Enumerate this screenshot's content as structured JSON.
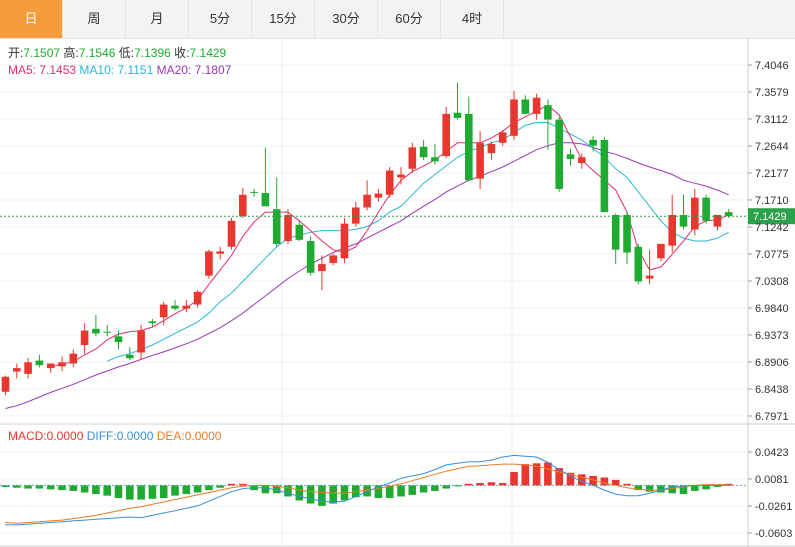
{
  "tabs": [
    {
      "label": "日",
      "active": true
    },
    {
      "label": "周",
      "active": false
    },
    {
      "label": "月",
      "active": false
    },
    {
      "label": "5分",
      "active": false
    },
    {
      "label": "15分",
      "active": false
    },
    {
      "label": "30分",
      "active": false
    },
    {
      "label": "60分",
      "active": false
    },
    {
      "label": "4时",
      "active": false
    }
  ],
  "ohlc_legend": {
    "open_label": "开:",
    "open_value": "7.1507",
    "high_label": "高:",
    "high_value": "7.1546",
    "low_label": "低:",
    "low_value": "7.1396",
    "close_label": "收:",
    "close_value": "7.1429"
  },
  "ma_legend": {
    "ma5_label": "MA5:",
    "ma5_value": "7.1453",
    "ma10_label": "MA10:",
    "ma10_value": "7.1151",
    "ma20_label": "MA20:",
    "ma20_value": "7.1807"
  },
  "macd_legend": {
    "macd_label": "MACD:",
    "macd_value": "0.0000",
    "diff_label": "DIFF:",
    "diff_value": "0.0000",
    "dea_label": "DEA:",
    "dea_value": "0.0000"
  },
  "colors": {
    "up": "#e8372e",
    "down": "#1fab32",
    "ma5": "#e0306a",
    "ma10": "#2bb6d8",
    "ma20": "#9a3ab8",
    "diff": "#3a8edb",
    "dea": "#ef7b20",
    "last_price_line": "#2aa14b"
  },
  "chart_data": {
    "type": "candlestick",
    "last_price": 7.1429,
    "last_price_label": "7.1429",
    "price_axis": {
      "min": 6.7971,
      "max": 7.4046,
      "ticks": [
        "7.4046",
        "7.3579",
        "7.3112",
        "7.2644",
        "7.2177",
        "7.1710",
        "7.1242",
        "7.0775",
        "7.0308",
        "6.9840",
        "6.9373",
        "6.8906",
        "6.8438",
        "6.7971"
      ]
    },
    "candles": [
      [
        6.839,
        6.867,
        6.833,
        6.865
      ],
      [
        6.874,
        6.888,
        6.862,
        6.88
      ],
      [
        6.87,
        6.898,
        6.862,
        6.89
      ],
      [
        6.893,
        6.903,
        6.881,
        6.885
      ],
      [
        6.88,
        6.888,
        6.872,
        6.888
      ],
      [
        6.883,
        6.9,
        6.875,
        6.89
      ],
      [
        6.888,
        6.912,
        6.882,
        6.905
      ],
      [
        6.92,
        6.958,
        6.905,
        6.945
      ],
      [
        6.948,
        6.972,
        6.935,
        6.94
      ],
      [
        6.943,
        6.955,
        6.935,
        6.942
      ],
      [
        6.935,
        6.945,
        6.912,
        6.925
      ],
      [
        6.903,
        6.916,
        6.894,
        6.897
      ],
      [
        6.907,
        6.955,
        6.895,
        6.945
      ],
      [
        6.961,
        6.965,
        6.952,
        6.958
      ],
      [
        6.968,
        6.995,
        6.955,
        6.99
      ],
      [
        6.988,
        6.998,
        6.98,
        6.983
      ],
      [
        6.983,
        6.998,
        6.977,
        6.988
      ],
      [
        6.99,
        7.015,
        6.985,
        7.012
      ],
      [
        7.04,
        7.085,
        7.035,
        7.082
      ],
      [
        7.078,
        7.09,
        7.068,
        7.082
      ],
      [
        7.09,
        7.14,
        7.085,
        7.135
      ],
      [
        7.143,
        7.192,
        7.14,
        7.18
      ],
      [
        7.185,
        7.19,
        7.176,
        7.184
      ],
      [
        7.183,
        7.262,
        7.17,
        7.16
      ],
      [
        7.155,
        7.21,
        7.09,
        7.095
      ],
      [
        7.1,
        7.155,
        7.095,
        7.145
      ],
      [
        7.128,
        7.135,
        7.1,
        7.102
      ],
      [
        7.1,
        7.108,
        7.04,
        7.045
      ],
      [
        7.048,
        7.075,
        7.015,
        7.06
      ],
      [
        7.062,
        7.078,
        7.058,
        7.075
      ],
      [
        7.07,
        7.14,
        7.062,
        7.13
      ],
      [
        7.13,
        7.168,
        7.125,
        7.158
      ],
      [
        7.158,
        7.205,
        7.153,
        7.18
      ],
      [
        7.175,
        7.19,
        7.168,
        7.182
      ],
      [
        7.18,
        7.228,
        7.175,
        7.222
      ],
      [
        7.21,
        7.228,
        7.198,
        7.215
      ],
      [
        7.225,
        7.27,
        7.218,
        7.262
      ],
      [
        7.263,
        7.275,
        7.24,
        7.245
      ],
      [
        7.245,
        7.268,
        7.232,
        7.238
      ],
      [
        7.247,
        7.332,
        7.243,
        7.32
      ],
      [
        7.322,
        7.374,
        7.31,
        7.313
      ],
      [
        7.32,
        7.35,
        7.205,
        7.205
      ],
      [
        7.208,
        7.29,
        7.19,
        7.27
      ],
      [
        7.252,
        7.272,
        7.24,
        7.268
      ],
      [
        7.27,
        7.292,
        7.265,
        7.288
      ],
      [
        7.282,
        7.36,
        7.275,
        7.345
      ],
      [
        7.345,
        7.352,
        7.32,
        7.32
      ],
      [
        7.32,
        7.355,
        7.31,
        7.348
      ],
      [
        7.335,
        7.345,
        7.258,
        7.31
      ],
      [
        7.31,
        7.315,
        7.185,
        7.19
      ],
      [
        7.25,
        7.26,
        7.23,
        7.242
      ],
      [
        7.235,
        7.252,
        7.225,
        7.245
      ],
      [
        7.275,
        7.282,
        7.255,
        7.265
      ],
      [
        7.275,
        7.28,
        7.15,
        7.15
      ],
      [
        7.145,
        7.148,
        7.06,
        7.085
      ],
      [
        7.145,
        7.15,
        7.06,
        7.08
      ],
      [
        7.09,
        7.095,
        7.025,
        7.03
      ],
      [
        7.035,
        7.085,
        7.025,
        7.04
      ],
      [
        7.07,
        7.095,
        7.065,
        7.095
      ],
      [
        7.092,
        7.18,
        7.08,
        7.145
      ],
      [
        7.145,
        7.18,
        7.12,
        7.125
      ],
      [
        7.12,
        7.19,
        7.11,
        7.175
      ],
      [
        7.175,
        7.18,
        7.13,
        7.135
      ],
      [
        7.125,
        7.145,
        7.118,
        7.145
      ],
      [
        7.15,
        7.155,
        7.14,
        7.143
      ]
    ],
    "ma5": [
      null,
      null,
      null,
      null,
      6.882,
      6.887,
      6.891,
      6.903,
      6.913,
      6.929,
      6.939,
      6.943,
      6.945,
      6.951,
      6.962,
      6.974,
      6.984,
      6.998,
      7.025,
      7.05,
      7.075,
      7.108,
      7.133,
      7.15,
      7.15,
      7.15,
      7.135,
      7.118,
      7.1,
      7.085,
      7.08,
      7.09,
      7.118,
      7.15,
      7.18,
      7.205,
      7.22,
      7.23,
      7.24,
      7.255,
      7.27,
      7.27,
      7.27,
      7.278,
      7.29,
      7.305,
      7.315,
      7.325,
      7.335,
      7.318,
      7.28,
      7.24,
      7.222,
      7.205,
      7.188,
      7.15,
      7.085,
      7.05,
      7.055,
      7.077,
      7.1,
      7.125,
      7.135,
      7.137,
      7.145
    ],
    "ma10": [
      null,
      null,
      null,
      null,
      null,
      null,
      null,
      null,
      null,
      6.892,
      6.9,
      6.905,
      6.912,
      6.92,
      6.93,
      6.94,
      6.95,
      6.96,
      6.975,
      6.995,
      7.01,
      7.03,
      7.05,
      7.07,
      7.09,
      7.105,
      7.11,
      7.115,
      7.118,
      7.118,
      7.118,
      7.12,
      7.125,
      7.135,
      7.15,
      7.16,
      7.18,
      7.2,
      7.215,
      7.23,
      7.245,
      7.255,
      7.262,
      7.27,
      7.275,
      7.288,
      7.3,
      7.305,
      7.305,
      7.295,
      7.285,
      7.275,
      7.26,
      7.245,
      7.225,
      7.21,
      7.185,
      7.16,
      7.135,
      7.115,
      7.105,
      7.1,
      7.1,
      7.105,
      7.115
    ],
    "ma20": [
      6.81,
      6.815,
      6.822,
      6.83,
      6.838,
      6.845,
      6.852,
      6.86,
      6.868,
      6.875,
      6.882,
      6.888,
      6.895,
      6.902,
      6.908,
      6.915,
      6.922,
      6.93,
      6.94,
      6.95,
      6.962,
      6.975,
      6.99,
      7.005,
      7.02,
      7.035,
      7.048,
      7.06,
      7.07,
      7.08,
      7.088,
      7.095,
      7.105,
      7.115,
      7.125,
      7.135,
      7.148,
      7.16,
      7.172,
      7.185,
      7.195,
      7.205,
      7.212,
      7.22,
      7.228,
      7.238,
      7.248,
      7.258,
      7.265,
      7.27,
      7.27,
      7.268,
      7.262,
      7.255,
      7.25,
      7.243,
      7.235,
      7.228,
      7.222,
      7.215,
      7.205,
      7.2,
      7.195,
      7.188,
      7.18
    ],
    "macd_axis": {
      "min": -0.0603,
      "max": 0.0423,
      "ticks": [
        "0.0423",
        "0.0081",
        "-0.0261",
        "-0.0603"
      ]
    },
    "macd_hist": [
      -0.002,
      -0.003,
      -0.004,
      -0.004,
      -0.005,
      -0.006,
      -0.007,
      -0.009,
      -0.011,
      -0.013,
      -0.016,
      -0.018,
      -0.018,
      -0.017,
      -0.016,
      -0.013,
      -0.011,
      -0.009,
      -0.006,
      -0.003,
      0.002,
      0.002,
      -0.006,
      -0.01,
      -0.01,
      -0.014,
      -0.019,
      -0.023,
      -0.026,
      -0.023,
      -0.019,
      -0.015,
      -0.014,
      -0.016,
      -0.016,
      -0.014,
      -0.012,
      -0.009,
      -0.007,
      -0.004,
      -0.001,
      0.002,
      0.003,
      0.004,
      0.003,
      0.017,
      0.027,
      0.028,
      0.029,
      0.022,
      0.016,
      0.014,
      0.012,
      0.01,
      0.007,
      0.002,
      -0.006,
      -0.008,
      -0.009,
      -0.01,
      -0.011,
      -0.007,
      -0.005,
      -0.002,
      0.002,
      0.001,
      -0.001,
      -0.001,
      0.0
    ],
    "diff": [
      -0.05,
      -0.05,
      -0.049,
      -0.048,
      -0.047,
      -0.046,
      -0.045,
      -0.044,
      -0.043,
      -0.042,
      -0.041,
      -0.04,
      -0.041,
      -0.038,
      -0.035,
      -0.032,
      -0.029,
      -0.026,
      -0.02,
      -0.014,
      -0.008,
      -0.004,
      -0.003,
      -0.003,
      -0.006,
      -0.01,
      -0.014,
      -0.017,
      -0.02,
      -0.021,
      -0.02,
      -0.014,
      -0.008,
      -0.002,
      0.003,
      0.009,
      0.012,
      0.015,
      0.02,
      0.026,
      0.028,
      0.03,
      0.03,
      0.032,
      0.036,
      0.038,
      0.037,
      0.036,
      0.029,
      0.02,
      0.012,
      0.005,
      0.0,
      -0.006,
      -0.011,
      -0.013,
      -0.013,
      -0.01,
      -0.006,
      -0.002,
      -0.001,
      0.0,
      0.0,
      0.0,
      0.0
    ],
    "dea": [
      -0.047,
      -0.048,
      -0.047,
      -0.046,
      -0.045,
      -0.044,
      -0.042,
      -0.04,
      -0.038,
      -0.035,
      -0.032,
      -0.029,
      -0.027,
      -0.024,
      -0.021,
      -0.018,
      -0.015,
      -0.012,
      -0.009,
      -0.006,
      -0.003,
      -0.001,
      0.0,
      0.0,
      -0.001,
      -0.003,
      -0.006,
      -0.008,
      -0.009,
      -0.01,
      -0.01,
      -0.008,
      -0.006,
      -0.004,
      -0.001,
      0.002,
      0.006,
      0.01,
      0.014,
      0.018,
      0.021,
      0.024,
      0.025,
      0.026,
      0.027,
      0.027,
      0.026,
      0.024,
      0.021,
      0.017,
      0.014,
      0.01,
      0.007,
      0.003,
      0.0,
      -0.003,
      -0.005,
      -0.006,
      -0.006,
      -0.004,
      -0.002,
      0.0,
      0.001,
      0.001,
      0.001
    ]
  }
}
